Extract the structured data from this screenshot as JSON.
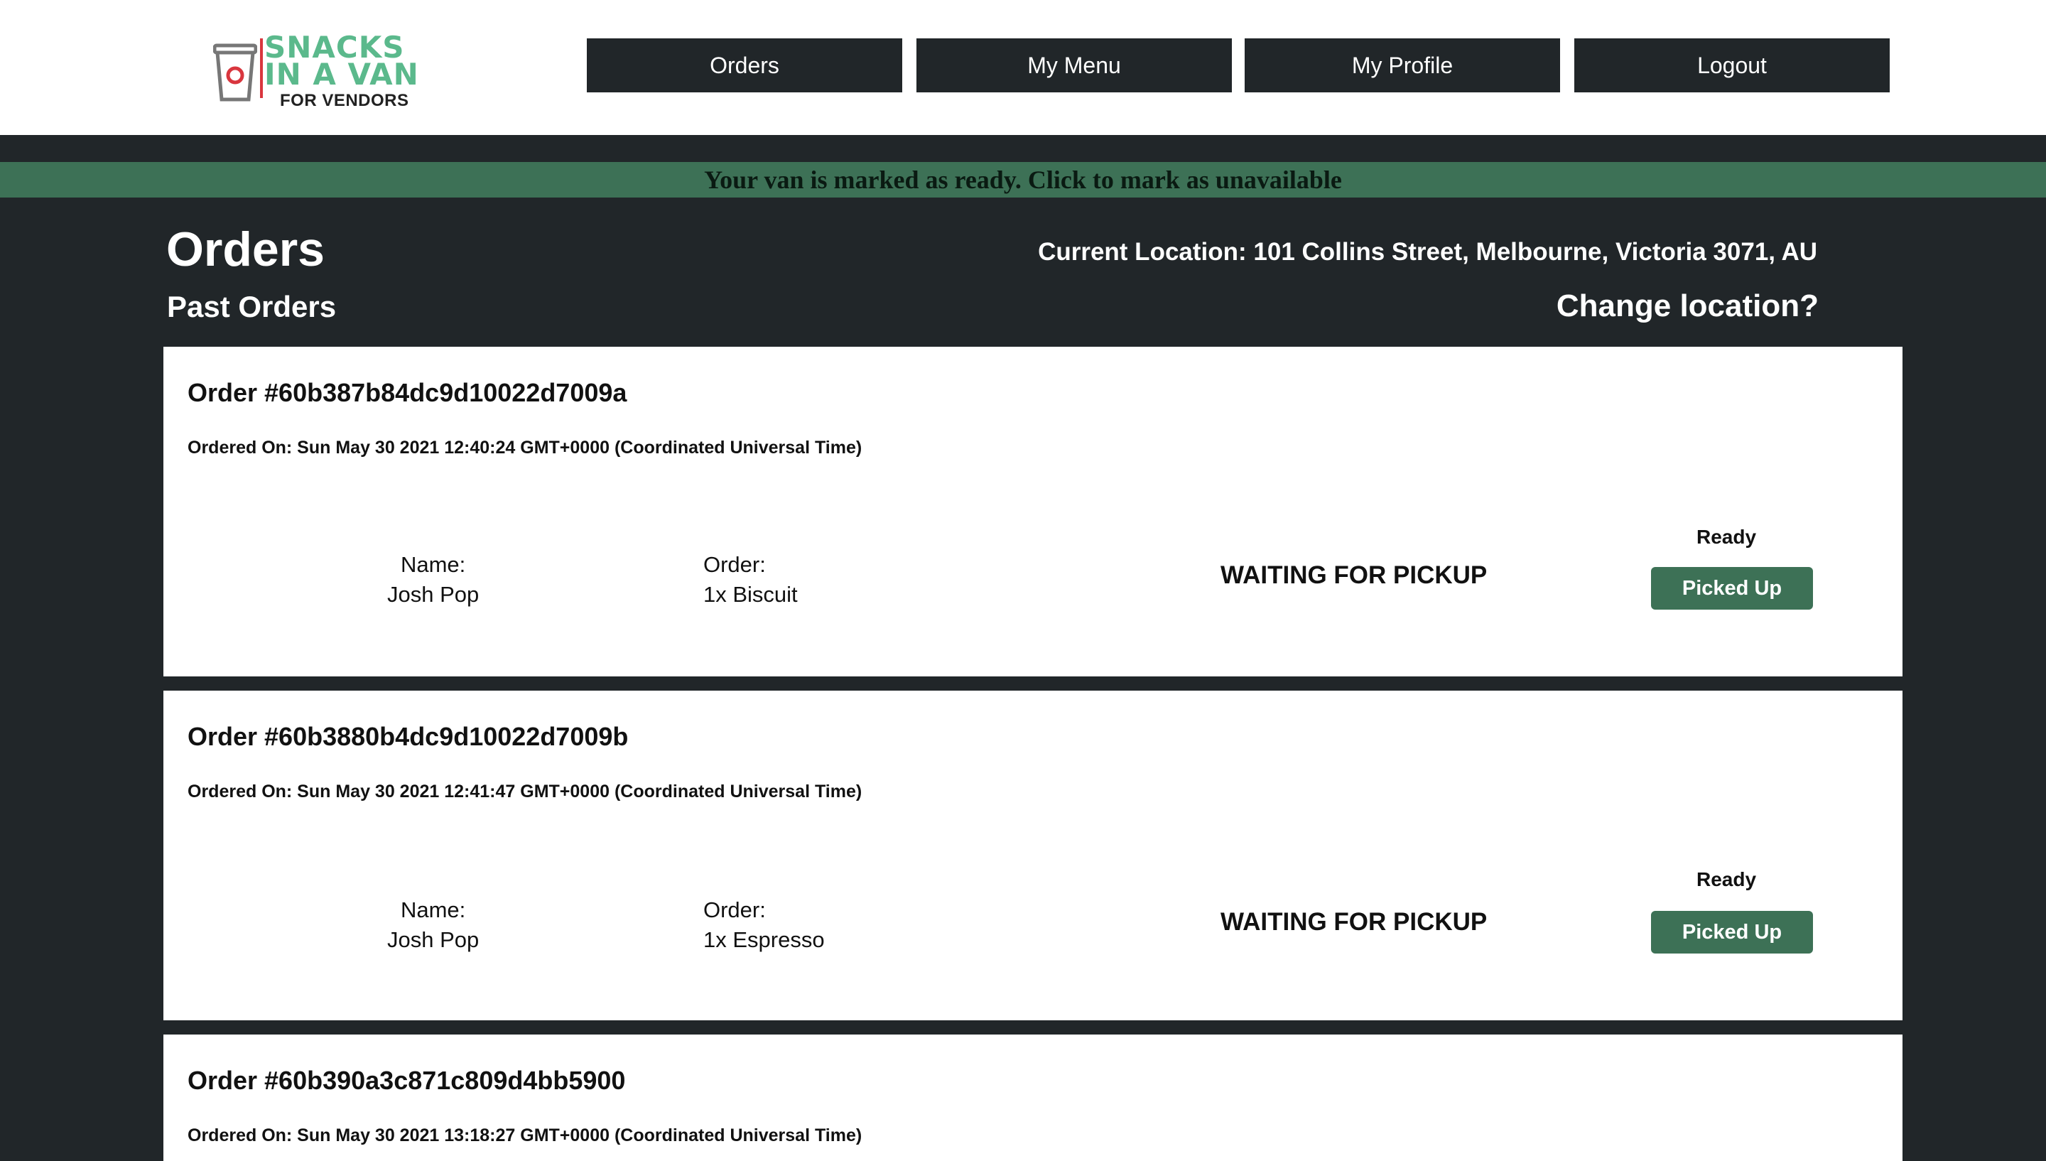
{
  "brand": {
    "logo_line1": "SNACKS",
    "logo_line2": "IN A VAN",
    "logo_sub": "FOR VENDORS",
    "accent": "#5bb98c",
    "logo_red": "#d9363e"
  },
  "nav": {
    "items": [
      {
        "label": "Orders"
      },
      {
        "label": "My Menu"
      },
      {
        "label": "My Profile"
      },
      {
        "label": "Logout"
      }
    ]
  },
  "banner": {
    "text": "Your van is marked as ready. Click to mark as unavailable",
    "color": "#3d7156"
  },
  "page": {
    "title": "Orders",
    "subtitle": "Past Orders",
    "current_location": "Current Location: 101 Collins Street, Melbourne, Victoria 3071, AU",
    "change_location": "Change location?"
  },
  "orders": [
    {
      "id": "Order #60b387b84dc9d10022d7009a",
      "ordered_on": "Ordered On: Sun May 30 2021 12:40:24 GMT+0000 (Coordinated Universal Time)",
      "name_label": "Name:",
      "name": "Josh Pop",
      "order_label": "Order:",
      "items": "1x Biscuit",
      "status": "WAITING FOR PICKUP",
      "ready_label": "Ready",
      "action": "Picked Up"
    },
    {
      "id": "Order #60b3880b4dc9d10022d7009b",
      "ordered_on": "Ordered On: Sun May 30 2021 12:41:47 GMT+0000 (Coordinated Universal Time)",
      "name_label": "Name:",
      "name": "Josh Pop",
      "order_label": "Order:",
      "items": "1x Espresso",
      "status": "WAITING FOR PICKUP",
      "ready_label": "Ready",
      "action": "Picked Up"
    },
    {
      "id": "Order #60b390a3c871c809d4bb5900",
      "ordered_on": "Ordered On: Sun May 30 2021 13:18:27 GMT+0000 (Coordinated Universal Time)"
    }
  ]
}
